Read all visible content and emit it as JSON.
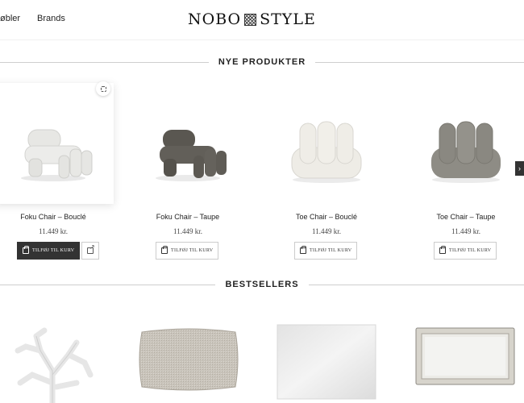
{
  "header": {
    "nav": [
      {
        "label": "øbler"
      },
      {
        "label": "Brands"
      }
    ],
    "logo_left": "NOBO",
    "logo_right": "STYLE"
  },
  "new_products": {
    "title": "NYE PRODUKTER",
    "products": [
      {
        "name": "Foku Chair – Bouclé",
        "price": "11.449 kr.",
        "button": "TILFØJ TIL KURV",
        "color": "#ececea"
      },
      {
        "name": "Foku Chair – Taupe",
        "price": "11.449 kr.",
        "button": "TILFØJ TIL KURV",
        "color": "#5e5b55"
      },
      {
        "name": "Toe Chair – Bouclé",
        "price": "11.449 kr.",
        "button": "TILFØJ TIL KURV",
        "color": "#eeece6"
      },
      {
        "name": "Toe Chair – Taupe",
        "price": "11.449 kr.",
        "button": "TILFØJ TIL KURV",
        "color": "#8e8c85"
      }
    ]
  },
  "bestsellers": {
    "title": "BESTSELLERS"
  },
  "colors": {
    "button_dark": "#333333",
    "divider": "#cfcfcf"
  }
}
